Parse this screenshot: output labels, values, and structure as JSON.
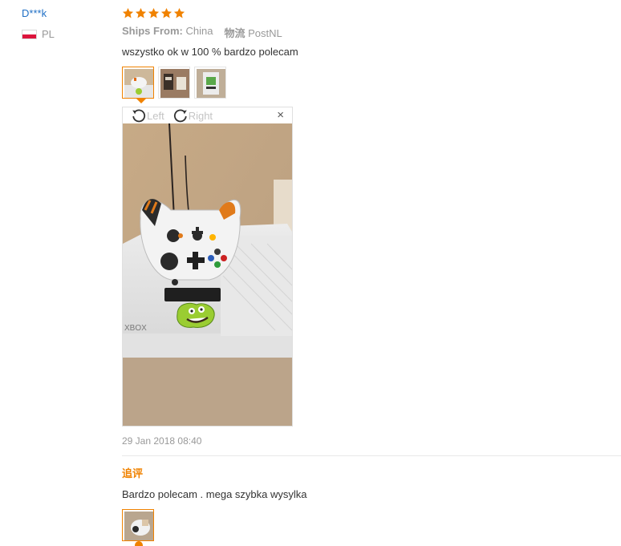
{
  "reviewer": {
    "name": "D***k",
    "country": "PL"
  },
  "rating": {
    "stars": 5,
    "max": 5,
    "color": "#f08200"
  },
  "shipping": {
    "label": "Ships From:",
    "origin": "China",
    "logistics_label": "物流",
    "logistics": "PostNL"
  },
  "review": {
    "text": "wszystko ok w 100 % bardzo polecam",
    "date": "29 Jan 2018 08:40"
  },
  "thumbnails": [
    {
      "name": "photo-1",
      "active": true
    },
    {
      "name": "photo-2",
      "active": false
    },
    {
      "name": "photo-3",
      "active": false
    }
  ],
  "viewer": {
    "rotate_left_label": "Left",
    "rotate_right_label": "Right",
    "close_label": "×",
    "icons": [
      "rotate-left-icon",
      "rotate-right-icon",
      "close-icon"
    ]
  },
  "followup": {
    "title": "追评",
    "text": "Bardzo polecam . mega szybka wysylka"
  },
  "colors": {
    "accent": "#f08200",
    "link": "#1f6fc5",
    "muted": "#999999"
  }
}
